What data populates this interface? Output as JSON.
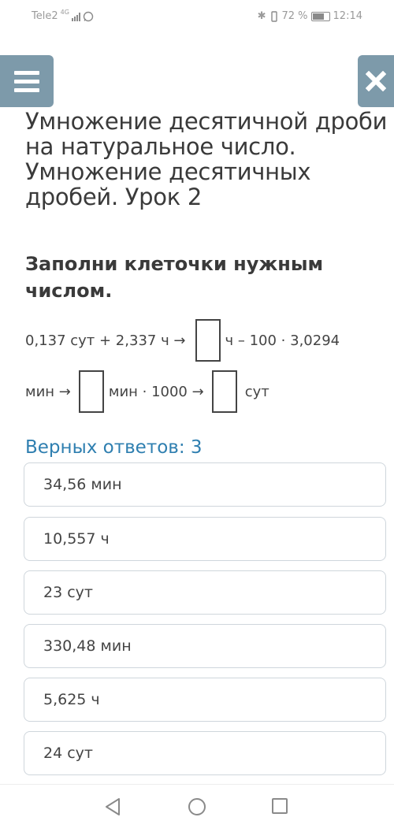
{
  "status_bar": {
    "carrier": "Tele2",
    "network": "4G",
    "battery_percent": "72 %",
    "time": "12:14"
  },
  "header": {
    "title": "Умножение десятичной дроби на натуральное число. Умножение десятичных дробей. Урок 2"
  },
  "task": {
    "instruction": "Заполни клеточки нужным числом.",
    "line1_part1": "0,137 сут + 2,337 ч →",
    "line1_part2": "ч – 100 · 3,0294",
    "line2_part1": "мин →",
    "line2_part2": "мин · 1000 →",
    "line2_part3": "сут"
  },
  "answers": {
    "correct_label": "Верных ответов: 3",
    "options": [
      "34,56 мин",
      "10,557 ч",
      "23 сут",
      "330,48 мин",
      "5,625 ч",
      "24 сут"
    ]
  },
  "icons": {
    "menu": "hamburger-icon",
    "close": "close-icon",
    "back": "back-triangle-icon",
    "home": "home-circle-icon",
    "recents": "recents-square-icon"
  },
  "colors": {
    "header_buttons": "#7d9aaa",
    "correct_label": "#2f7fb0"
  }
}
